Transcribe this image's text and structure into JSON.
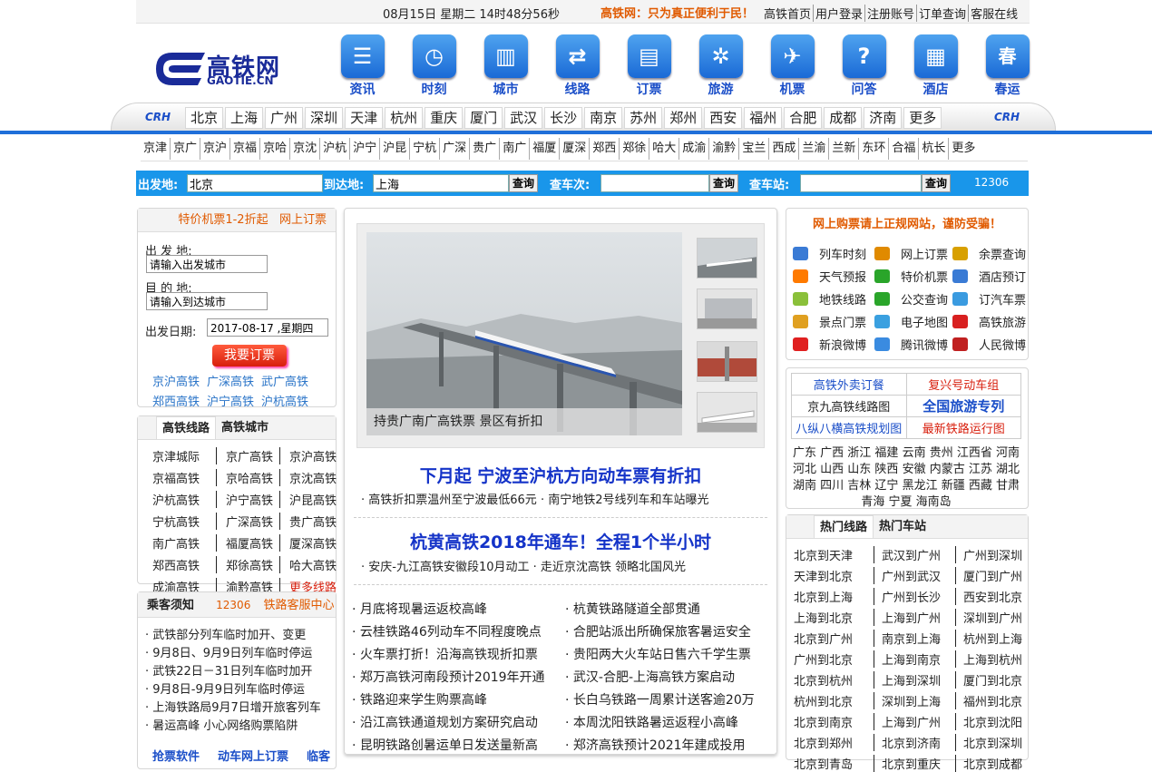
{
  "topbar": {
    "datetime": "08月15日 星期二 14时48分56秒",
    "slogan": "高铁网：只为真正便利于民！",
    "links": [
      "高铁首页",
      "用户登录",
      "注册账号",
      "订单查询",
      "客服在线"
    ]
  },
  "logo": {
    "cn": "高铁网",
    "en": "GAOTIE.CN"
  },
  "mainnav": [
    {
      "label": "资讯",
      "icon": "list-icon",
      "glyph": "☰"
    },
    {
      "label": "时刻",
      "icon": "clock-icon",
      "glyph": "◷"
    },
    {
      "label": "城市",
      "icon": "city-icon",
      "glyph": "▥"
    },
    {
      "label": "线路",
      "icon": "shuffle-icon",
      "glyph": "⇄"
    },
    {
      "label": "订票",
      "icon": "ticket-icon",
      "glyph": "▤"
    },
    {
      "label": "旅游",
      "icon": "compass-icon",
      "glyph": "✲"
    },
    {
      "label": "机票",
      "icon": "plane-icon",
      "glyph": "✈"
    },
    {
      "label": "问答",
      "icon": "question-icon",
      "glyph": "?"
    },
    {
      "label": "酒店",
      "icon": "hotel-icon",
      "glyph": "▦"
    },
    {
      "label": "春运",
      "icon": "spring-icon",
      "glyph": "春"
    }
  ],
  "crh": "CRH",
  "cities": [
    "北京",
    "上海",
    "广州",
    "深圳",
    "天津",
    "杭州",
    "重庆",
    "厦门",
    "武汉",
    "长沙",
    "南京",
    "苏州",
    "郑州",
    "西安",
    "福州",
    "合肥",
    "成都",
    "济南",
    "更多"
  ],
  "routes": [
    "京津",
    "京广",
    "京沪",
    "京福",
    "京哈",
    "京沈",
    "沪杭",
    "沪宁",
    "沪昆",
    "宁杭",
    "广深",
    "贵广",
    "南广",
    "福厦",
    "厦深",
    "郑西",
    "郑徐",
    "哈大",
    "成渝",
    "渝黔",
    "宝兰",
    "西成",
    "兰渝",
    "兰新",
    "东环",
    "合福",
    "杭长",
    "更多"
  ],
  "search": {
    "from_label": "出发地:",
    "from_value": "北京",
    "to_label": "到达地:",
    "to_value": "上海",
    "btn": "查询",
    "train_label": "查车次:",
    "station_label": "查车站:",
    "hotline": "12306"
  },
  "ticket_panel": {
    "header1": "特价机票1-2折起",
    "header2": "网上订票",
    "from_label": "出 发 地:",
    "from_placeholder": "请输入出发城市",
    "to_label": "目 的 地:",
    "to_placeholder": "请输入到达城市",
    "date_label": "出发日期:",
    "date_value": "2017-08-17 ,星期四",
    "order_btn": "我要订票",
    "links": [
      "京沪高铁",
      "广深高铁",
      "武广高铁",
      "郑西高铁",
      "沪宁高铁",
      "沪杭高铁"
    ]
  },
  "lines_panel": {
    "tab1": "高铁线路",
    "tab2": "高铁城市",
    "items": [
      "京津城际",
      "京广高铁",
      "京沪高铁",
      "京福高铁",
      "京哈高铁",
      "京沈高铁",
      "沪杭高铁",
      "沪宁高铁",
      "沪昆高铁",
      "宁杭高铁",
      "广深高铁",
      "贵广高铁",
      "南广高铁",
      "福厦高铁",
      "厦深高铁",
      "郑西高铁",
      "郑徐高铁",
      "哈大高铁",
      "成渝高铁",
      "渝黔高铁",
      "更多线路"
    ]
  },
  "notice_panel": {
    "title": "乘客须知",
    "hotline": "12306",
    "service": "铁路客服中心",
    "items": [
      "武铁部分列车临时加开、变更",
      "9月8日、9月9日列车临时停运",
      "武铁22日－31日列车临时加开",
      "9月8日-9月9日列车临时停运",
      "上海铁路局9月7日增开旅客列车",
      "暑运高峰 小心网络购票陷阱"
    ],
    "footer": [
      "抢票软件",
      "动车网上订票",
      "临客"
    ]
  },
  "slider": {
    "caption": "持贵广南广高铁票 景区有折扣"
  },
  "headline1": {
    "title": "下月起 宁波至沪杭方向动车票有折扣",
    "sub": "· 高铁折扣票温州至宁波最低66元 · 南宁地铁2号线列车和车站曝光"
  },
  "headline2": {
    "title": "杭黄高铁2018年通车！全程1个半小时",
    "sub": "· 安庆-九江高铁安徽段10月动工 · 走近京沈高铁 领略北国风光"
  },
  "news": [
    "月底将现暑运返校高峰",
    "杭黄铁路隧道全部贯通",
    "云桂铁路46列动车不同程度晚点",
    "合肥站派出所确保旅客暑运安全",
    "火车票打折！沿海高铁现折扣票",
    "贵阳两大火车站日售六千学生票",
    "郑万高铁河南段预计2019年开通",
    "武汉-合肥-上海高铁方案启动",
    "铁路迎来学生购票高峰",
    "长白乌铁路一周累计送客逾20万",
    "沿江高铁通道规划方案研究启动",
    "本周沈阳铁路暑运返程小高峰",
    "昆明铁路创暑运单日发送量新高",
    "郑济高铁预计2021年建成投用"
  ],
  "right_panel": {
    "warning": "网上购票请上正规网站，谨防受骗！",
    "services": [
      {
        "label": "列车时刻",
        "icon": "train-icon",
        "color": "#3a7bd5"
      },
      {
        "label": "网上订票",
        "icon": "ticket-icon",
        "color": "#e08a00"
      },
      {
        "label": "余票查询",
        "icon": "query-icon",
        "color": "#d8a000"
      },
      {
        "label": "天气预报",
        "icon": "weather-icon",
        "color": "#ff7a00"
      },
      {
        "label": "特价机票",
        "icon": "plane-icon",
        "color": "#2aa52a"
      },
      {
        "label": "酒店预订",
        "icon": "hotel-icon",
        "color": "#3a7bd5"
      },
      {
        "label": "地铁线路",
        "icon": "metro-icon",
        "color": "#8ac03a"
      },
      {
        "label": "公交查询",
        "icon": "bus-icon",
        "color": "#2aa52a"
      },
      {
        "label": "订汽车票",
        "icon": "coach-icon",
        "color": "#3a9be0"
      },
      {
        "label": "景点门票",
        "icon": "scenic-icon",
        "color": "#e0a020"
      },
      {
        "label": "电子地图",
        "icon": "map-icon",
        "color": "#3aa0e0"
      },
      {
        "label": "高铁旅游",
        "icon": "car-icon",
        "color": "#d82020"
      },
      {
        "label": "新浪微博",
        "icon": "weibo-icon",
        "color": "#e02020"
      },
      {
        "label": "腾讯微博",
        "icon": "tencent-icon",
        "color": "#3a8be0"
      },
      {
        "label": "人民微博",
        "icon": "people-icon",
        "color": "#c02020"
      }
    ],
    "table": [
      [
        "高铁外卖订餐",
        "复兴号动车组"
      ],
      [
        "京九高铁线路图",
        "全国旅游专列"
      ],
      [
        "八纵八横高铁规划图",
        "最新铁路运行图"
      ]
    ],
    "provinces": [
      "广东",
      "广西",
      "浙江",
      "福建",
      "云南",
      "贵州",
      "江西省",
      "河南",
      "河北",
      "山西",
      "山东",
      "陕西",
      "安徽",
      "内蒙古",
      "江苏",
      "湖北",
      "湖南",
      "四川",
      "吉林",
      "辽宁",
      "黑龙江",
      "新疆",
      "西藏",
      "甘肃",
      "青海",
      "宁夏",
      "海南岛"
    ]
  },
  "hot_panel": {
    "tab1": "热门线路",
    "tab2": "热门车站",
    "items": [
      "北京到天津",
      "武汉到广州",
      "广州到深圳",
      "天津到北京",
      "广州到武汉",
      "厦门到广州",
      "北京到上海",
      "广州到长沙",
      "西安到北京",
      "上海到北京",
      "上海到广州",
      "深圳到广州",
      "北京到广州",
      "南京到上海",
      "杭州到上海",
      "广州到北京",
      "上海到南京",
      "上海到杭州",
      "北京到杭州",
      "上海到深圳",
      "厦门到北京",
      "杭州到北京",
      "深圳到上海",
      "福州到北京",
      "北京到南京",
      "上海到广州",
      "北京到沈阳",
      "北京到郑州",
      "北京到济南",
      "北京到深圳",
      "北京到青岛",
      "北京到重庆",
      "北京到成都"
    ]
  },
  "colors": {
    "accent": "#1f6fd9",
    "orange": "#e05a00",
    "headline": "#1433c8"
  }
}
